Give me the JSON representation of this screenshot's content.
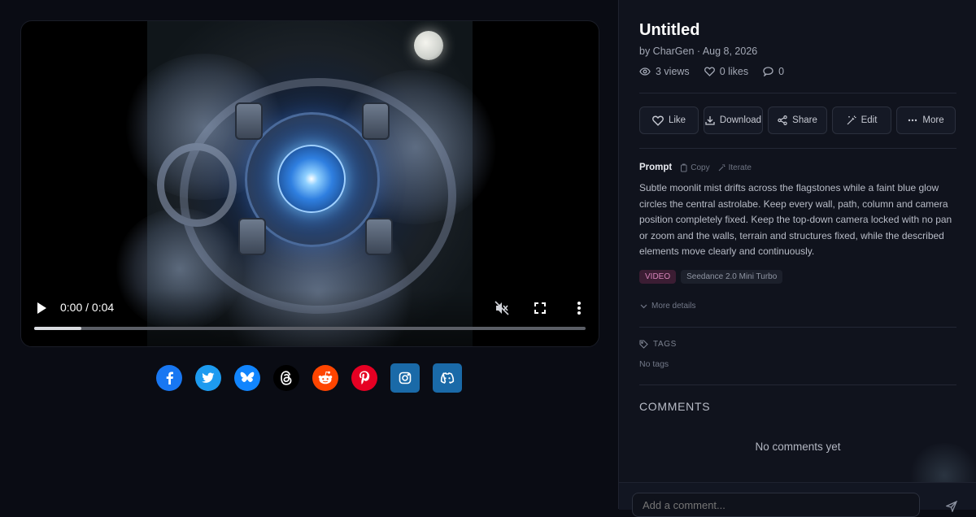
{
  "video": {
    "time": "0:00 / 0:04",
    "progress_fraction": 0.085,
    "icons": {
      "play": "play-icon",
      "mute": "volume-muted-icon",
      "fullscreen": "fullscreen-icon",
      "menu": "more-vertical-icon"
    }
  },
  "share": [
    {
      "name": "facebook",
      "color": "#1877f2"
    },
    {
      "name": "twitter",
      "color": "#1d9bf0"
    },
    {
      "name": "bluesky",
      "color": "#1185fe"
    },
    {
      "name": "threads",
      "color": "#000000"
    },
    {
      "name": "reddit",
      "color": "#ff4500"
    },
    {
      "name": "pinterest",
      "color": "#e60023"
    },
    {
      "name": "instagram",
      "color": "#1a6aa8"
    },
    {
      "name": "discord",
      "color": "#1a6aa8"
    }
  ],
  "post": {
    "title": "Untitled",
    "byline": "by CharGen · Aug 8, 2026",
    "stats": {
      "views": "3 views",
      "likes": "0 likes",
      "comments": "0"
    }
  },
  "actions": {
    "like": "Like",
    "download": "Download",
    "share": "Share",
    "edit": "Edit",
    "more": "More"
  },
  "prompt": {
    "label": "Prompt",
    "copy": "Copy",
    "iterate": "Iterate",
    "text": "Subtle moonlit mist drifts across the flagstones while a faint blue glow circles the central astrolabe. Keep every wall, path, column and camera position completely fixed. Keep the top-down camera locked with no pan or zoom and the walls, terrain and structures fixed, while the described elements move clearly and continuously."
  },
  "badges": {
    "type": "VIDEO",
    "model": "Seedance 2.0 Mini Turbo"
  },
  "more_details": "More details",
  "tags": {
    "heading": "TAGS",
    "empty": "No tags"
  },
  "comments": {
    "heading": "COMMENTS",
    "empty": "No comments yet",
    "placeholder": "Add a comment..."
  },
  "colors": {
    "accent_pink": "#d784b9",
    "background": "#0a0c14",
    "panel": "#10131d"
  }
}
